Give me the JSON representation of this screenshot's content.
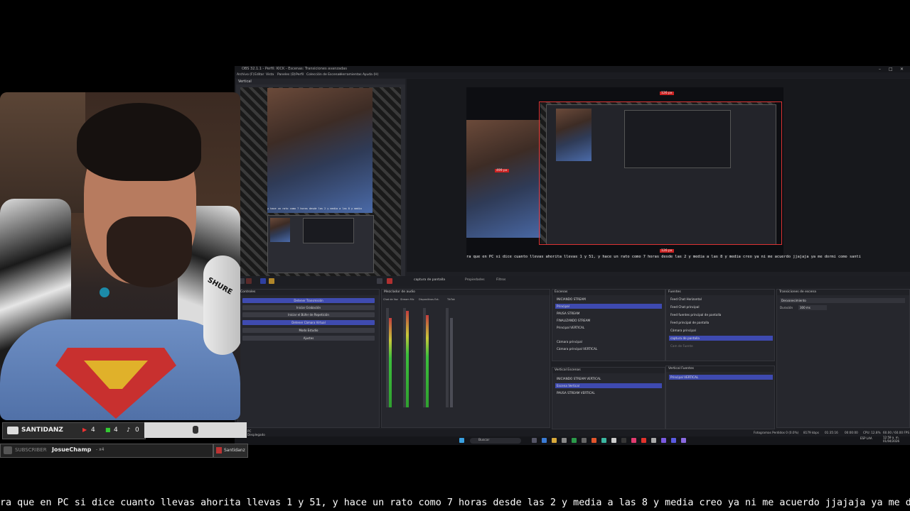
{
  "caption": "ra que en PC si dice cuanto llevas ahorita llevas 1 y 51, y hace un rato como 7 horas desde las 2 y media a las 8 y media creo ya ni me acuerdo jjajaja ya me dormi como santi",
  "overlay": {
    "streamer_name": "SANTIDANZ",
    "counts": {
      "youtube": "4",
      "kick": "4",
      "tiktok": "0"
    },
    "subscriber_label": "SUBSCRIBER",
    "subscriber_name": "JosueChamp",
    "subscriber_extra": "- x4",
    "small_name": "Santidanz",
    "mic_brand": "SHURE"
  },
  "obs": {
    "title": "OBS 32.1.1 - Perfil: KICK - Escenas: Transiciones avanzadas",
    "menu": [
      "Archivo (F)",
      "Editar",
      "Vista",
      "Paneles (D)",
      "Perfil",
      "Colección de Escenas",
      "Herramientas",
      "Ayuda (H)"
    ],
    "vertical_dock_title": "Vertical",
    "preview_caption": "ra que en PC si dice cuanto llevas ahorita llevas 1 y 51, y hace un rato como 7 horas desde las 2 y media a las 8 y media creo ya ni me acuerdo jjajaja ya me dormi como santi",
    "px_top": "126 px",
    "px_bottom": "126 px",
    "px_side": "499 px",
    "toolbar_source": "captura de pantalla",
    "toolbar_props": "Propiedades",
    "toolbar_filters": "Filtros",
    "controls": {
      "title": "Controles",
      "buttons": [
        "Detener Transmisión",
        "Iniciar Grabación",
        "Iniciar el Búfer de Repetición",
        "Detener Cámara Virtual",
        "Modo Estudio",
        "Ajustes"
      ]
    },
    "audio_mixer": {
      "title": "Mezclador de audio",
      "channels": [
        "Chat de Voz",
        "Stream Mic",
        "Dispositivos Ext.",
        "TikTok"
      ],
      "tabs": [
        "Global",
        "Global",
        "Activo",
        "Activo"
      ]
    },
    "scenes": {
      "title": "Escenas",
      "items": [
        "INICIANDO STREAM",
        "Principal",
        "PAUSA STREAM",
        "FINALIZANDO STREAM",
        "Principal VERTICAL",
        "Cámara principal",
        "Cámara principal VERTICAL"
      ],
      "selected": 1
    },
    "sources": {
      "title": "Fuentes",
      "items": [
        "Feed Chat Horizontal",
        "Feed Chat principal",
        "Feed fuentes principal de pantalla",
        "Feed principal de pantalla",
        "Cámara principal",
        "captura de pantalla",
        "Cam de Fuente"
      ],
      "selected": 5
    },
    "transitions": {
      "title": "Transiciones de escena",
      "type": "Desvanecimiento",
      "duration_label": "Duración",
      "duration": "300 ms"
    },
    "vertical_scenes": {
      "title": "Vertical Escenas",
      "items": [
        "INICIANDO STREAM VERTICAL",
        "Escena Vertical",
        "PAUSA STREAM VERTICAL"
      ],
      "selected": 1
    },
    "vertical_sources": {
      "title": "Vertical Fuentes",
      "items": [
        "Principal VERTICAL"
      ],
      "selected": 0
    },
    "status": {
      "frames": "Fotogramas Perdidos 0 (0.0%)",
      "bitrate": "8179 kbps",
      "time": "01:35:16",
      "rec": "00:00:00",
      "cpu": "CPU: 12.8%",
      "fps": "60.00 / 60.00 FPS",
      "profile": "PC",
      "hidden": "Desplegado"
    },
    "taskbar": {
      "search_placeholder": "Buscar",
      "lang": "ESP LAA",
      "clock_time": "12:59 a. m.",
      "clock_date": "01/04/2026"
    }
  }
}
